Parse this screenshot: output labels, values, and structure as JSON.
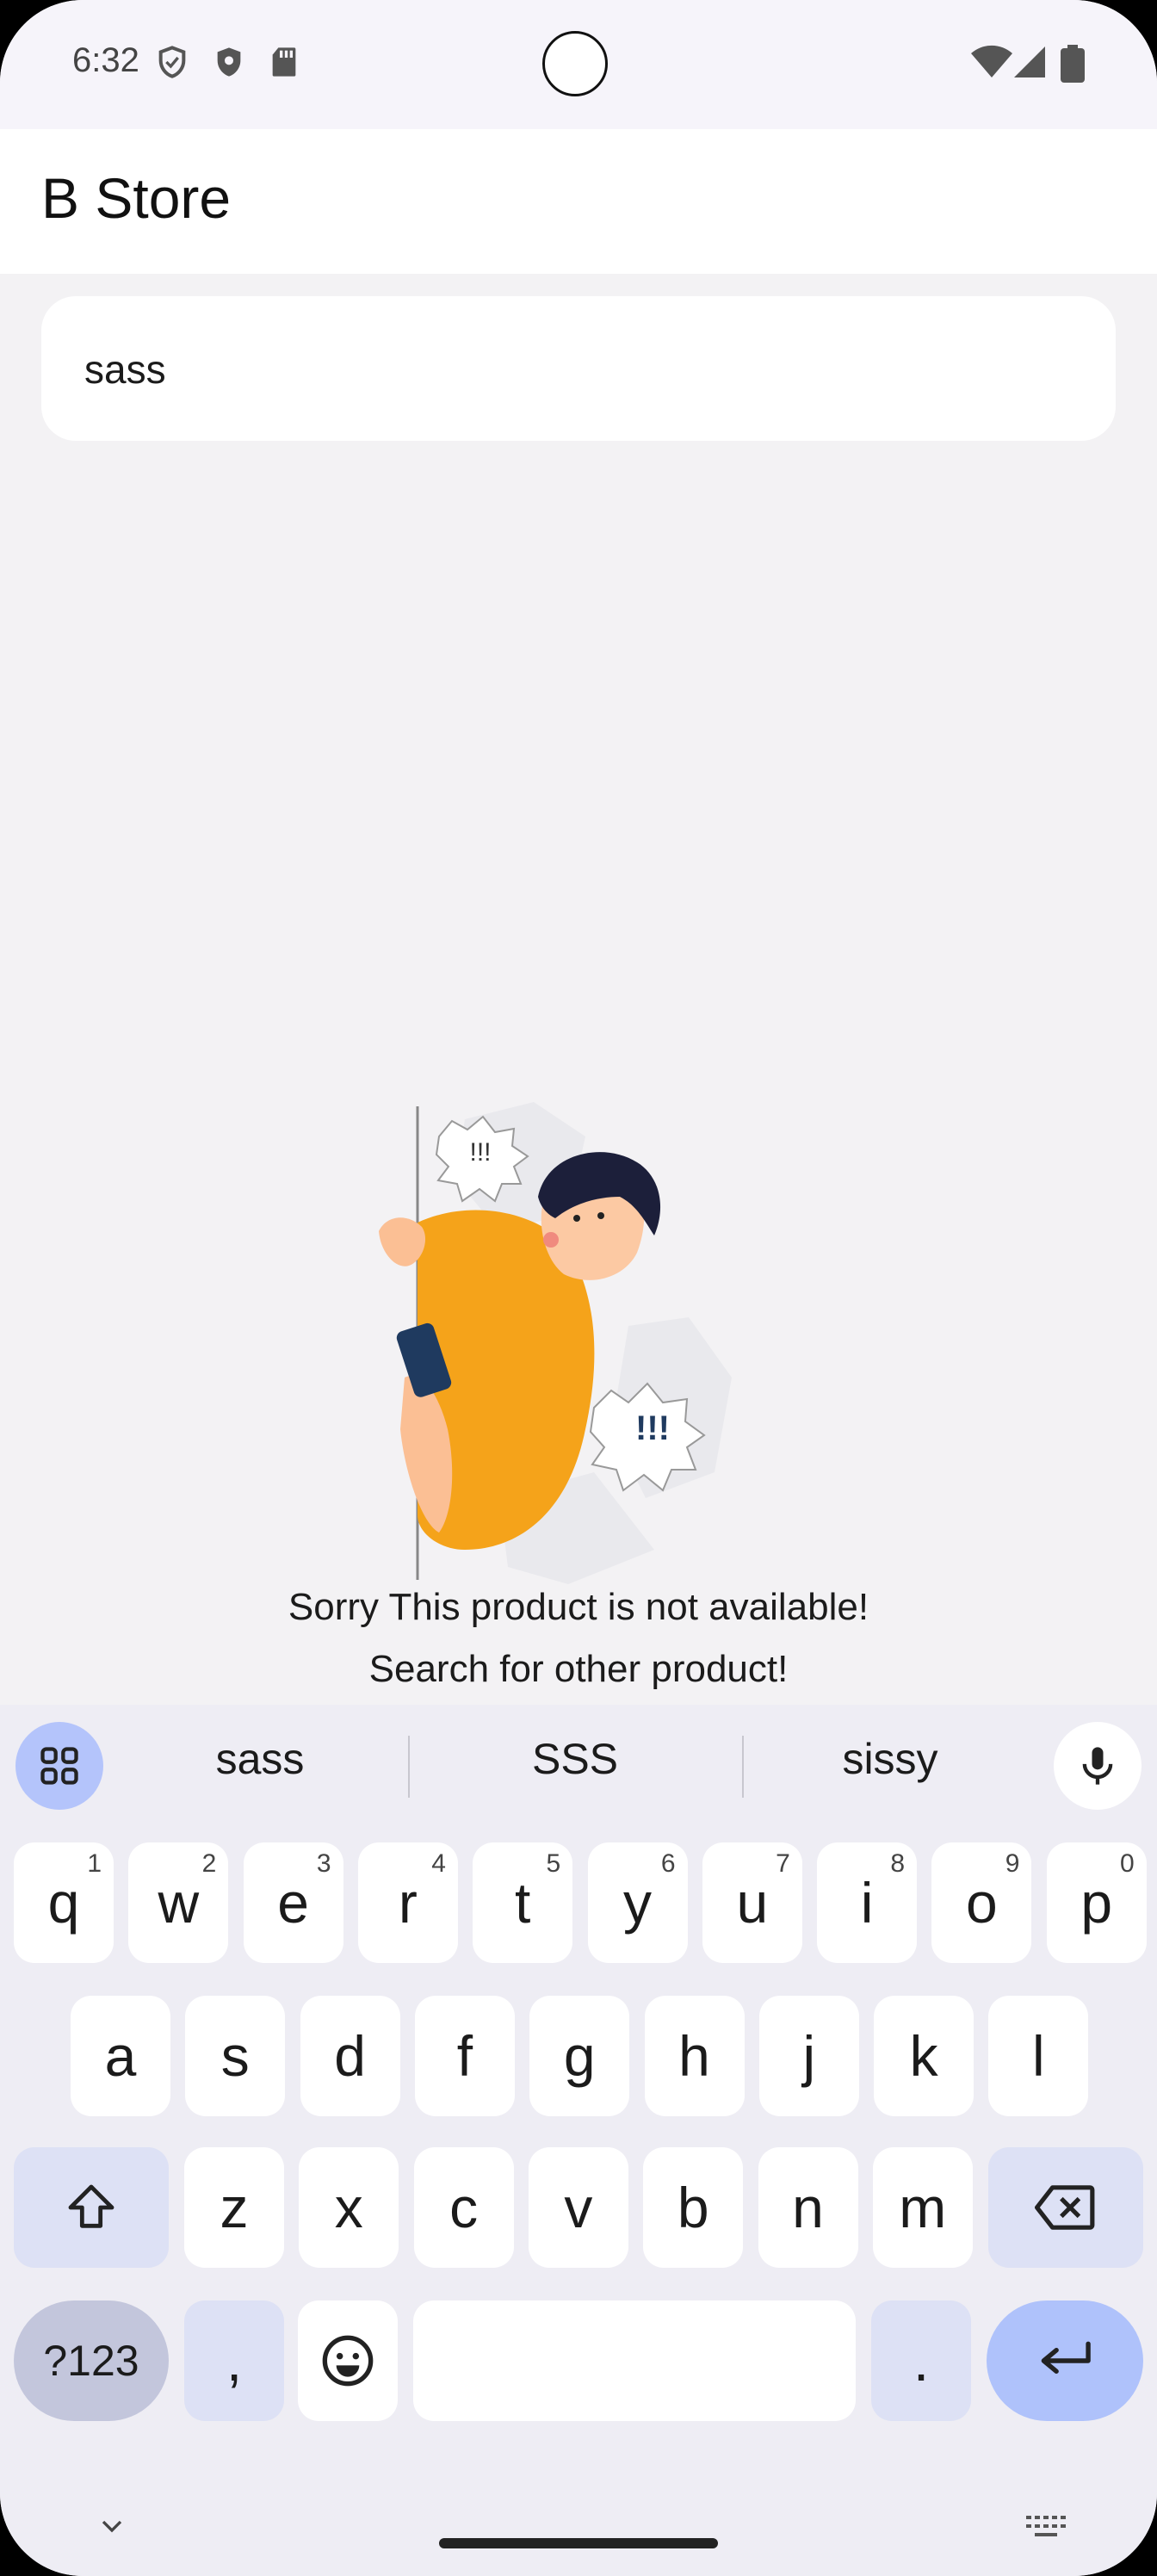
{
  "status_bar": {
    "time": "6:32"
  },
  "app": {
    "title": "B Store"
  },
  "search": {
    "value": "sass",
    "placeholder": ""
  },
  "empty_state": {
    "line1": "Sorry This product is not available!",
    "line2": "Search for other product!",
    "illustration_exclaim": "!!!"
  },
  "keyboard": {
    "suggestions": [
      "sass",
      "SSS",
      "sissy"
    ],
    "row1": [
      {
        "k": "q",
        "h": "1"
      },
      {
        "k": "w",
        "h": "2"
      },
      {
        "k": "e",
        "h": "3"
      },
      {
        "k": "r",
        "h": "4"
      },
      {
        "k": "t",
        "h": "5"
      },
      {
        "k": "y",
        "h": "6"
      },
      {
        "k": "u",
        "h": "7"
      },
      {
        "k": "i",
        "h": "8"
      },
      {
        "k": "o",
        "h": "9"
      },
      {
        "k": "p",
        "h": "0"
      }
    ],
    "row2": [
      "a",
      "s",
      "d",
      "f",
      "g",
      "h",
      "j",
      "k",
      "l"
    ],
    "row3": [
      "z",
      "x",
      "c",
      "v",
      "b",
      "n",
      "m"
    ],
    "symbols_label": "?123",
    "comma": ",",
    "period": "."
  },
  "colors": {
    "accent_blue": "#afc2fb",
    "shirt": "#f5a31a",
    "phone": "#1f3a5f"
  },
  "icons": [
    "shield-icon",
    "shield-filled-icon",
    "sd-card-icon",
    "wifi-icon",
    "signal-icon",
    "battery-icon",
    "grid-icon",
    "mic-icon",
    "shift-icon",
    "backspace-icon",
    "emoji-icon",
    "enter-icon",
    "chevron-down-icon",
    "keyboard-icon"
  ]
}
